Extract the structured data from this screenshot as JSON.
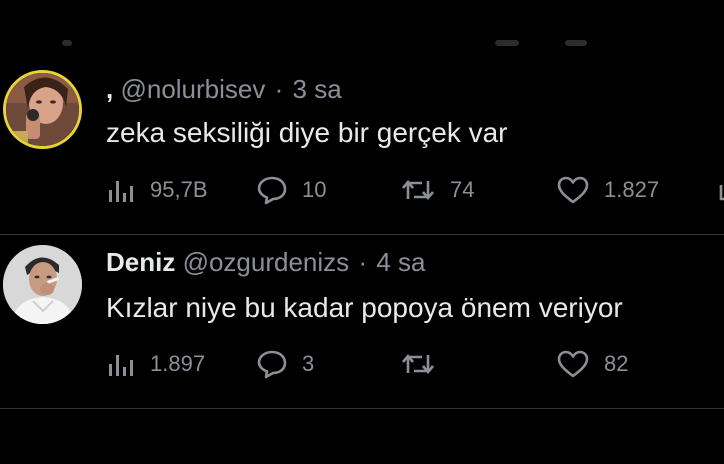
{
  "tweets": [
    {
      "display_name": ",",
      "handle": "@nolurbisev",
      "separator": "·",
      "time": "3 sa",
      "text": "zeka seksiliği diye bir gerçek var",
      "stats": {
        "views": "95,7B",
        "replies": "10",
        "retweets": "74",
        "likes": "1.827"
      },
      "avatar_ring_color": "#e6d23a"
    },
    {
      "display_name": "Deniz",
      "handle": "@ozgurdenizs",
      "separator": "·",
      "time": "4 sa",
      "text": "Kızlar niye bu kadar popoya önem veriyor",
      "stats": {
        "views": "1.897",
        "replies": "3",
        "retweets": "",
        "likes": "82"
      }
    }
  ],
  "icons": {
    "views": "bar-chart-icon",
    "reply": "speech-bubble-icon",
    "retweet": "retweet-arrows-icon",
    "like": "heart-icon",
    "share": "share-icon"
  },
  "colors": {
    "background": "#000000",
    "text": "#e7e9ea",
    "muted": "#8b9096",
    "separator": "#2f3336"
  }
}
